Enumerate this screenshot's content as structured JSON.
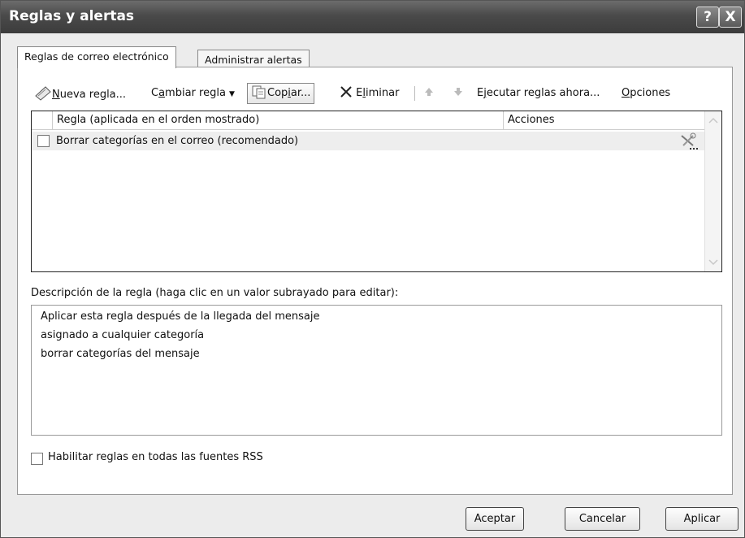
{
  "window": {
    "title": "Reglas y alertas",
    "help_glyph": "?",
    "close_glyph": "X"
  },
  "tabs": [
    {
      "label": "Reglas de correo electrónico",
      "active": true
    },
    {
      "label": "Administrar alertas",
      "active": false
    }
  ],
  "toolbar": {
    "new_rule": {
      "accel": "N",
      "rest": "ueva regla..."
    },
    "change_rule": {
      "pre": "C",
      "accel": "a",
      "rest": "mbiar regla"
    },
    "copy": {
      "pre": "Cop",
      "accel": "i",
      "rest": "ar..."
    },
    "delete": {
      "pre": "E",
      "accel": "l",
      "rest": "iminar"
    },
    "run_rules": {
      "pre": "E",
      "accel": "j",
      "rest": "ecutar reglas ahora..."
    },
    "options": {
      "accel": "O",
      "rest": "pciones"
    }
  },
  "rules_list": {
    "columns": [
      "Regla (aplicada en el orden mostrado)",
      "Acciones"
    ],
    "rows": [
      {
        "name": "Borrar categorías en el correo (recomendado)",
        "checked": false
      }
    ]
  },
  "description": {
    "label": "Descripción de la regla (haga clic en un valor subrayado para editar):",
    "lines": [
      "Aplicar esta regla después de la llegada del mensaje",
      "asignado a cualquier categoría",
      "borrar categorías del mensaje"
    ]
  },
  "rss_checkbox": {
    "label": "Habilitar reglas en todas las fuentes RSS",
    "checked": false
  },
  "buttons": {
    "ok": "Aceptar",
    "cancel": "Cancelar",
    "apply": "Aplicar"
  }
}
